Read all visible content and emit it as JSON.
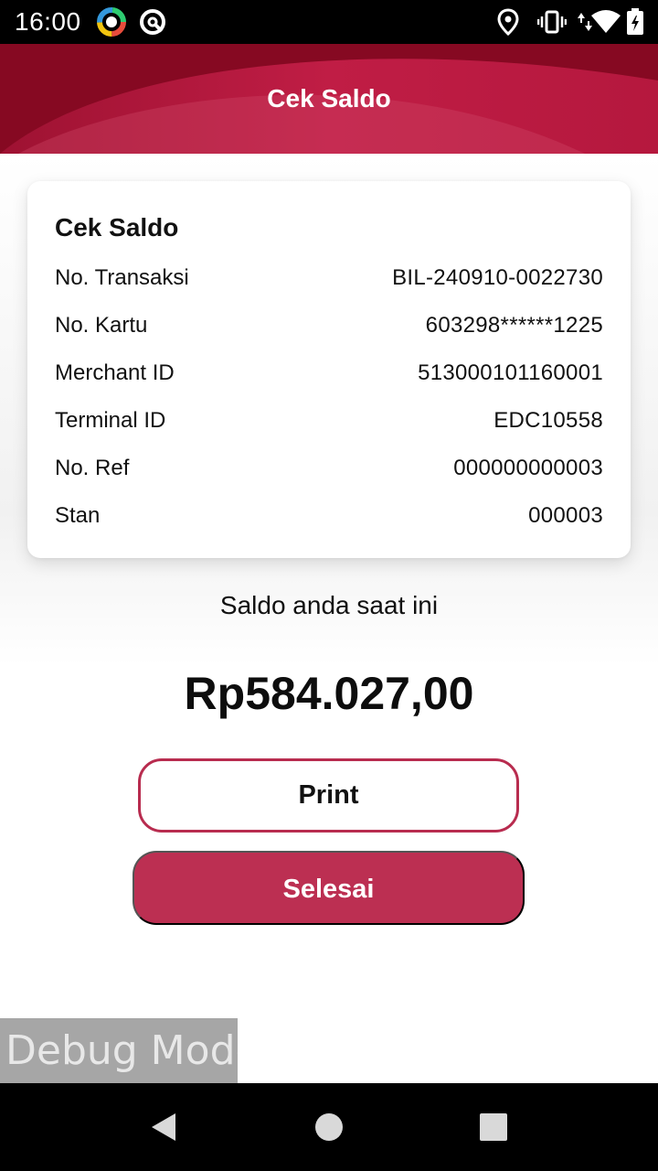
{
  "status_bar": {
    "time": "16:00",
    "icons": [
      "app-color-ring-icon",
      "app-q-icon",
      "location-icon",
      "vibrate-icon",
      "signal-icon",
      "wifi-icon",
      "battery-icon"
    ]
  },
  "header": {
    "title": "Cek Saldo"
  },
  "card": {
    "title": "Cek Saldo",
    "rows": [
      {
        "label": "No. Transaksi",
        "value": "BIL-240910-0022730"
      },
      {
        "label": "No. Kartu",
        "value": "603298******1225"
      },
      {
        "label": "Merchant ID",
        "value": "513000101160001"
      },
      {
        "label": "Terminal ID",
        "value": "EDC10558"
      },
      {
        "label": "No. Ref",
        "value": "000000000003"
      },
      {
        "label": "Stan",
        "value": "000003"
      }
    ]
  },
  "balance": {
    "label": "Saldo anda saat ini",
    "value": "Rp584.027,00"
  },
  "buttons": {
    "print": "Print",
    "done": "Selesai"
  },
  "debug_label": "Debug Mode",
  "colors": {
    "header_dark": "#8a0a26",
    "header_light": "#c01d45",
    "accent": "#bc2f52",
    "print_border": "#b82c4f"
  },
  "nav": {
    "icons": [
      "back-triangle-icon",
      "home-circle-icon",
      "recents-square-icon"
    ]
  }
}
